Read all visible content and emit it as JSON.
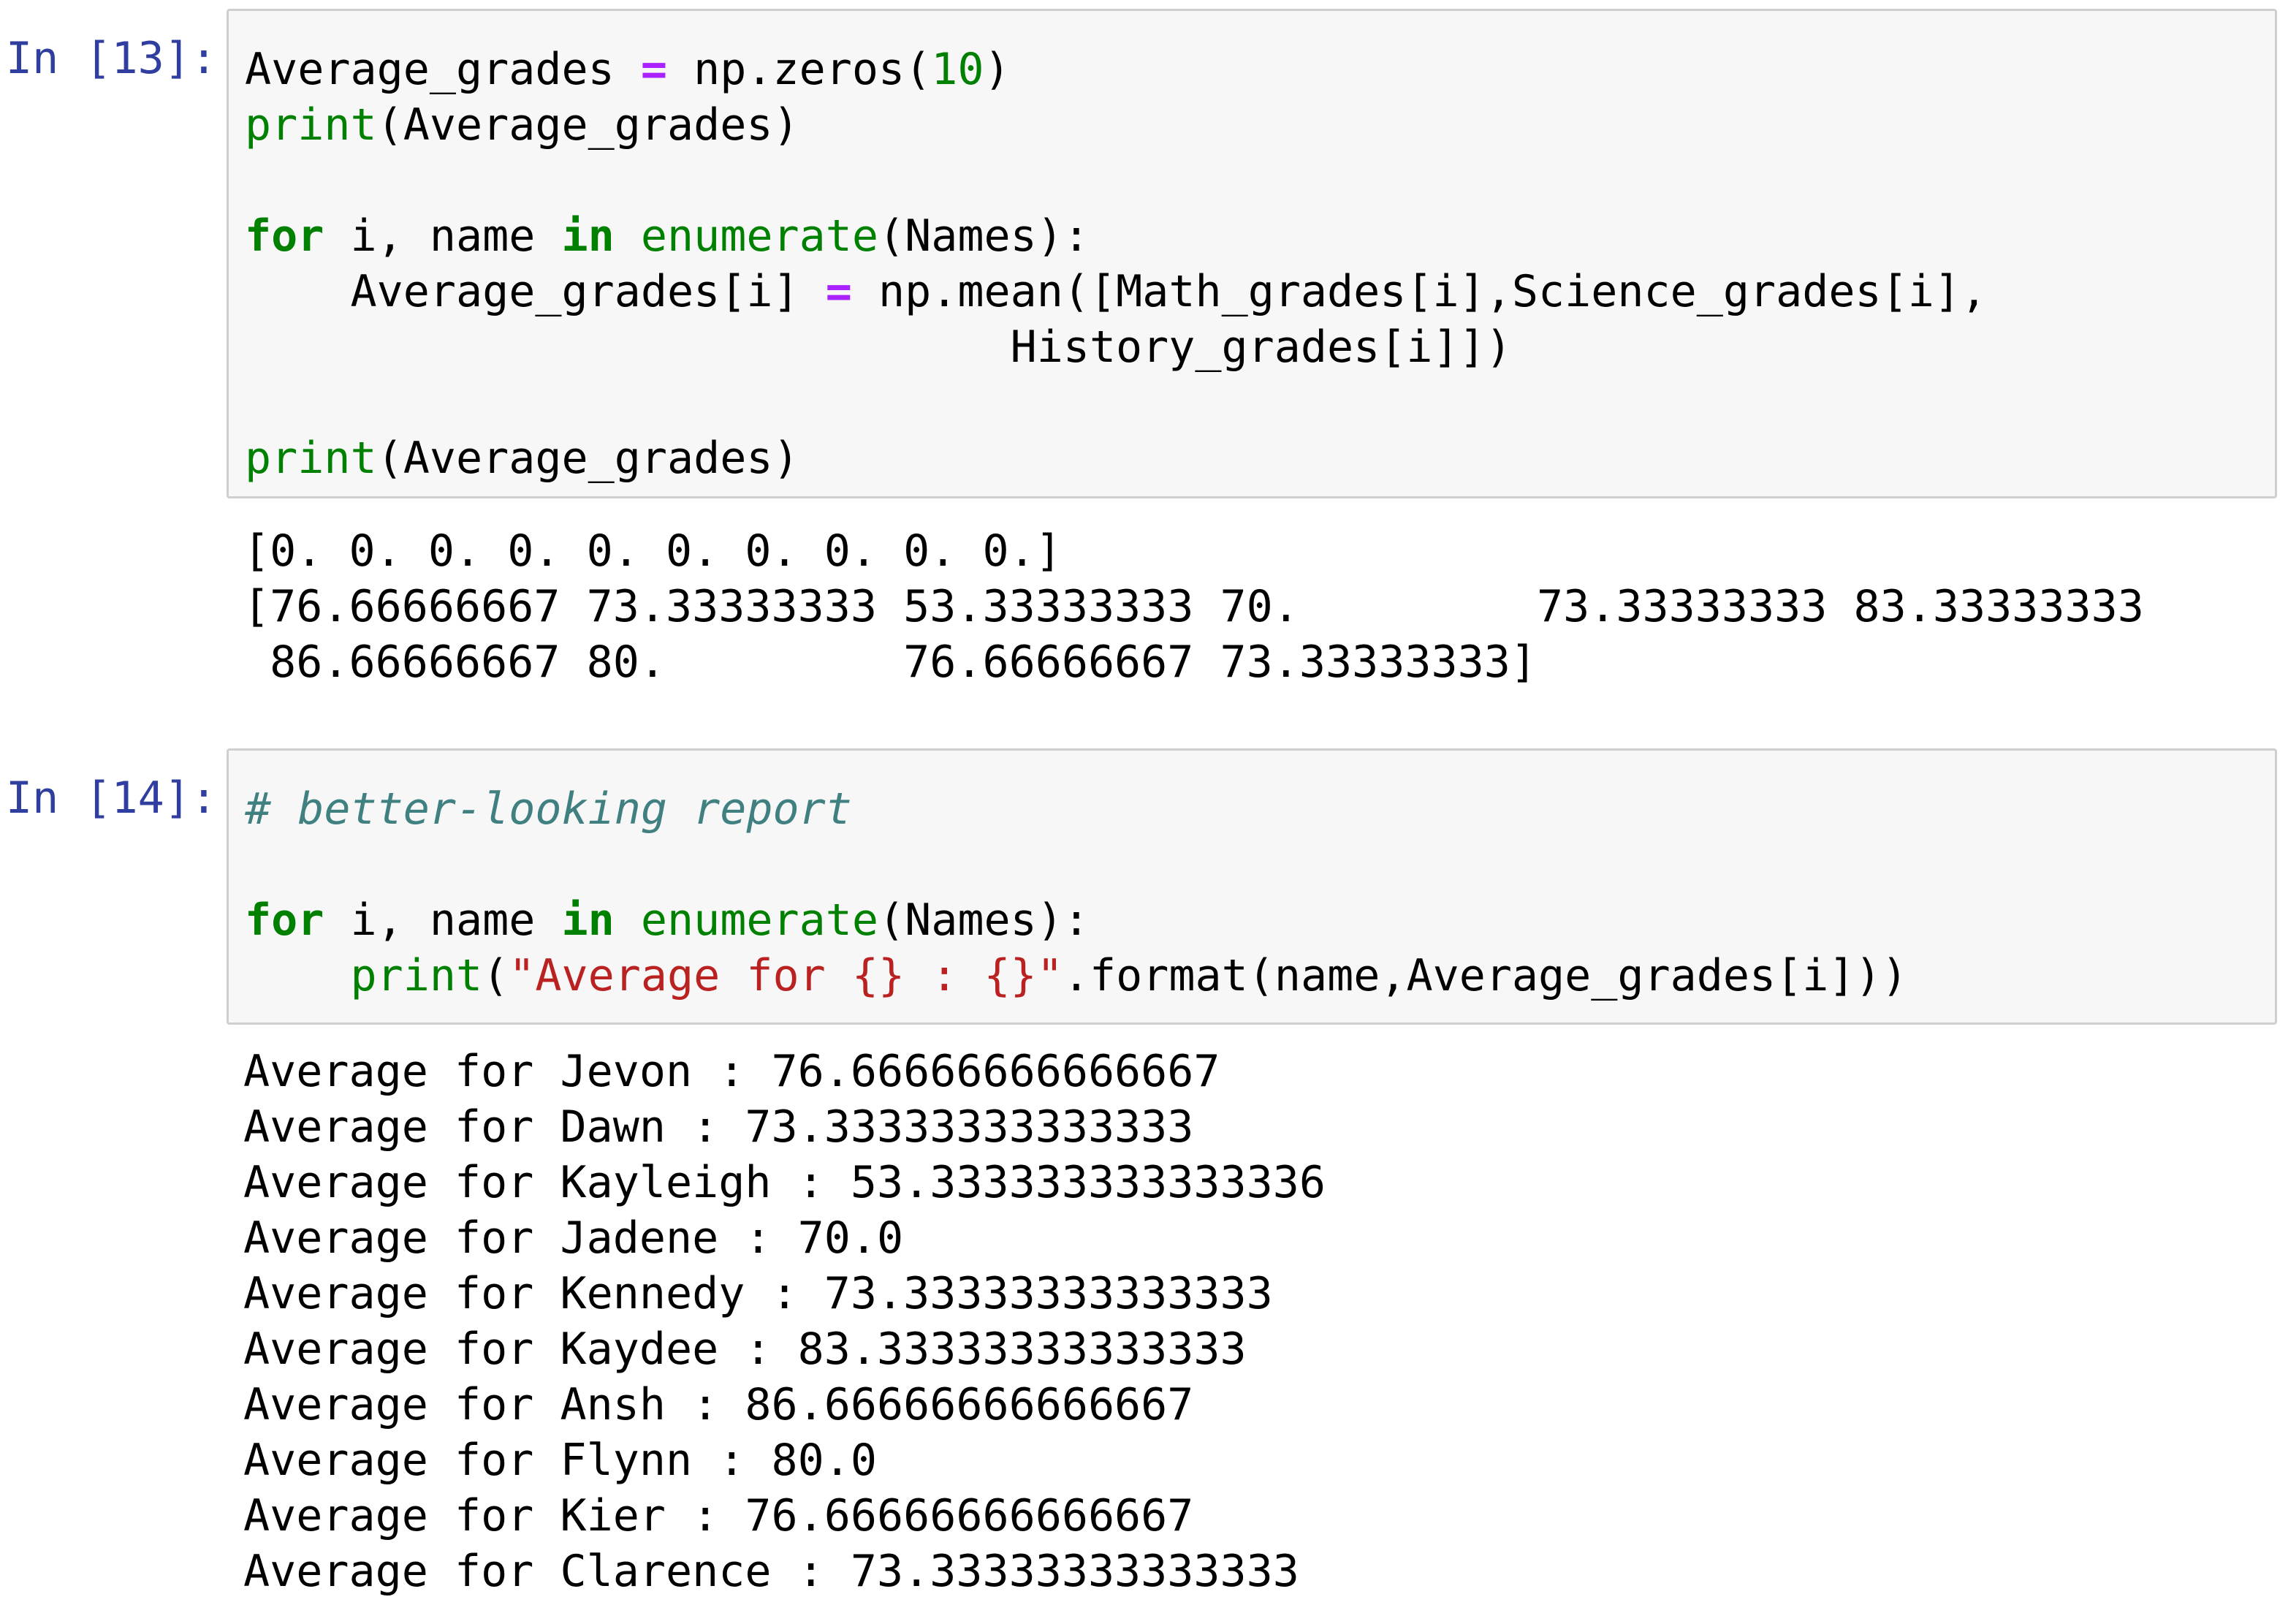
{
  "cells": [
    {
      "prompt": "In [13]:",
      "code_lines": [
        [
          {
            "t": "Average_grades ",
            "c": "txt"
          },
          {
            "t": "=",
            "c": "op"
          },
          {
            "t": " np.zeros(",
            "c": "txt"
          },
          {
            "t": "10",
            "c": "num"
          },
          {
            "t": ")",
            "c": "txt"
          }
        ],
        [
          {
            "t": "print",
            "c": "bi"
          },
          {
            "t": "(Average_grades)",
            "c": "txt"
          }
        ],
        [],
        [
          {
            "t": "for",
            "c": "kw"
          },
          {
            "t": " i, name ",
            "c": "txt"
          },
          {
            "t": "in",
            "c": "kw"
          },
          {
            "t": " ",
            "c": "txt"
          },
          {
            "t": "enumerate",
            "c": "bi"
          },
          {
            "t": "(Names):",
            "c": "txt"
          }
        ],
        [
          {
            "t": "    Average_grades[i] ",
            "c": "txt"
          },
          {
            "t": "=",
            "c": "op"
          },
          {
            "t": " np.mean([Math_grades[i],Science_grades[i],",
            "c": "txt"
          }
        ],
        [
          {
            "t": "                             History_grades[i]])",
            "c": "txt"
          }
        ],
        [],
        [
          {
            "t": "print",
            "c": "bi"
          },
          {
            "t": "(Average_grades)",
            "c": "txt"
          }
        ]
      ],
      "output_lines": [
        "[0. 0. 0. 0. 0. 0. 0. 0. 0. 0.]",
        "[76.66666667 73.33333333 53.33333333 70.         73.33333333 83.33333333",
        " 86.66666667 80.         76.66666667 73.33333333]"
      ]
    },
    {
      "prompt": "In [14]:",
      "code_lines": [
        [
          {
            "t": "# better-looking report",
            "c": "cm"
          }
        ],
        [],
        [
          {
            "t": "for",
            "c": "kw"
          },
          {
            "t": " i, name ",
            "c": "txt"
          },
          {
            "t": "in",
            "c": "kw"
          },
          {
            "t": " ",
            "c": "txt"
          },
          {
            "t": "enumerate",
            "c": "bi"
          },
          {
            "t": "(Names):",
            "c": "txt"
          }
        ],
        [
          {
            "t": "    ",
            "c": "txt"
          },
          {
            "t": "print",
            "c": "bi"
          },
          {
            "t": "(",
            "c": "txt"
          },
          {
            "t": "\"Average for {} : {}\"",
            "c": "str"
          },
          {
            "t": ".format(name,Average_grades[i]))",
            "c": "txt"
          }
        ]
      ],
      "output_lines": [
        "Average for Jevon : 76.66666666666667",
        "Average for Dawn : 73.33333333333333",
        "Average for Kayleigh : 53.333333333333336",
        "Average for Jadene : 70.0",
        "Average for Kennedy : 73.33333333333333",
        "Average for Kaydee : 83.33333333333333",
        "Average for Ansh : 86.66666666666667",
        "Average for Flynn : 80.0",
        "Average for Kier : 76.66666666666667",
        "Average for Clarence : 73.33333333333333"
      ]
    }
  ]
}
